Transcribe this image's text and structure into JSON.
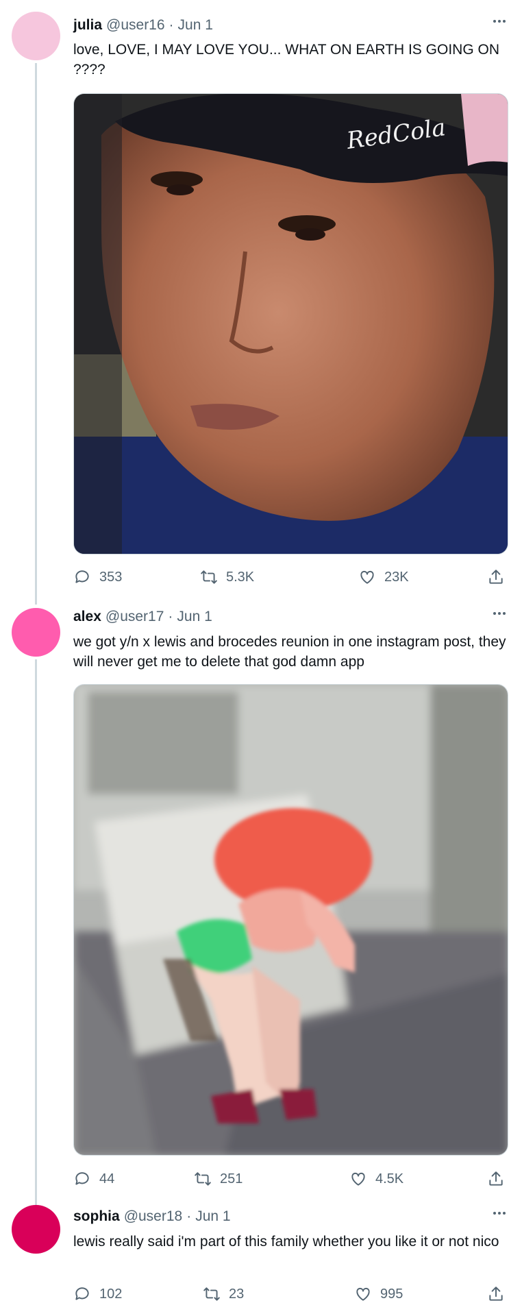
{
  "tweets": [
    {
      "name": "julia",
      "handle": "@user16",
      "date": "Jun 1",
      "text": "love, LOVE, I MAY LOVE YOU... WHAT ON EARTH IS GOING ON ????",
      "avatar_color": "#f6c6dd",
      "media_desc": "close-up photo of a man in a cap",
      "cap_text": "RedCola",
      "replies": "353",
      "retweets": "5.3K",
      "likes": "23K"
    },
    {
      "name": "alex",
      "handle": "@user17",
      "date": "Jun 1",
      "text": "we got y/n x lewis and brocedes reunion in one instagram post, they will never get me to delete that god damn app",
      "avatar_color": "#ff5cae",
      "media_desc": "blurry animated figure by a sink",
      "replies": "44",
      "retweets": "251",
      "likes": "4.5K"
    },
    {
      "name": "sophia",
      "handle": "@user18",
      "date": "Jun 1",
      "text": "lewis really said i'm part of this family whether you like it or not nico",
      "avatar_color": "#d90059",
      "replies": "102",
      "retweets": "23",
      "likes": "995"
    }
  ],
  "colors": {
    "text": "#0f1419",
    "secondary": "#536471",
    "thread_line": "#cfd9de"
  }
}
